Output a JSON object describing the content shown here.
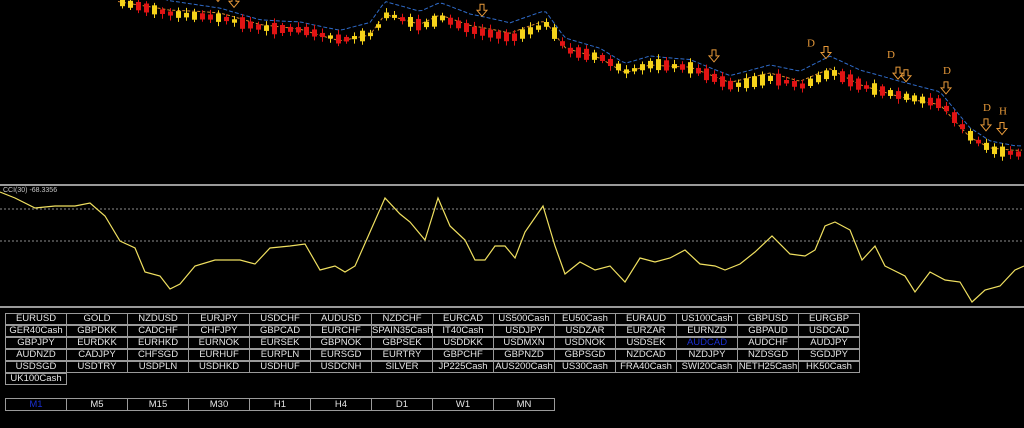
{
  "indicator": {
    "label": "CCI(30) -68.3356"
  },
  "colors": {
    "bull": "#f5d21a",
    "bear": "#e01414",
    "ma_blue": "#2f6bc9",
    "ma_orange": "#d8892a",
    "cci_line": "#f0e060",
    "arrow": "#e89a3a"
  },
  "symbols": [
    "EURUSD",
    "GOLD",
    "NZDUSD",
    "EURJPY",
    "USDCHF",
    "AUDUSD",
    "NZDCHF",
    "EURCAD",
    "US500Cash",
    "EU50Cash",
    "EURAUD",
    "US100Cash",
    "GBPUSD",
    "EURGBP",
    "GER40Cash",
    "GBPDKK",
    "CADCHF",
    "CHFJPY",
    "GBPCAD",
    "EURCHF",
    "SPAIN35Cash",
    "IT40Cash",
    "USDJPY",
    "USDZAR",
    "EURZAR",
    "EURNZD",
    "GBPAUD",
    "USDCAD",
    "GBPJPY",
    "EURDKK",
    "EURHKD",
    "EURNOK",
    "EURSEK",
    "GBPNOK",
    "GBPSEK",
    "USDDKK",
    "USDMXN",
    "USDNOK",
    "USDSEK",
    "AUDCAD",
    "AUDCHF",
    "AUDJPY",
    "AUDNZD",
    "CADJPY",
    "CHFSGD",
    "EURHUF",
    "EURPLN",
    "EURSGD",
    "EURTRY",
    "GBPCHF",
    "GBPNZD",
    "GBPSGD",
    "NZDCAD",
    "NZDJPY",
    "NZDSGD",
    "SGDJPY",
    "USDSGD",
    "USDTRY",
    "USDPLN",
    "USDHKD",
    "USDHUF",
    "USDCNH",
    "SILVER",
    "JP225Cash",
    "AUS200Cash",
    "US30Cash",
    "FRA40Cash",
    "SWI20Cash",
    "NETH25Cash",
    "HK50Cash",
    "UK100Cash"
  ],
  "active_symbol": "AUDCAD",
  "timeframes": [
    "M1",
    "M5",
    "M15",
    "M30",
    "H1",
    "H4",
    "D1",
    "W1",
    "MN"
  ],
  "active_timeframe": "M1",
  "signals": [
    {
      "i": 12,
      "type": "arrow"
    },
    {
      "i": 14,
      "type": "arrow"
    },
    {
      "i": 45,
      "type": "arrow"
    },
    {
      "i": 74,
      "type": "arrow"
    },
    {
      "i": 86,
      "type": "D"
    },
    {
      "i": 88,
      "type": "arrow"
    },
    {
      "i": 96,
      "type": "D"
    },
    {
      "i": 97,
      "type": "arrow"
    },
    {
      "i": 98,
      "type": "arrow"
    },
    {
      "i": 103,
      "type": "D"
    },
    {
      "i": 103,
      "type": "arrow"
    },
    {
      "i": 108,
      "type": "D"
    },
    {
      "i": 108,
      "type": "arrow"
    },
    {
      "i": 110,
      "type": "H"
    },
    {
      "i": 110,
      "type": "arrow"
    }
  ]
}
